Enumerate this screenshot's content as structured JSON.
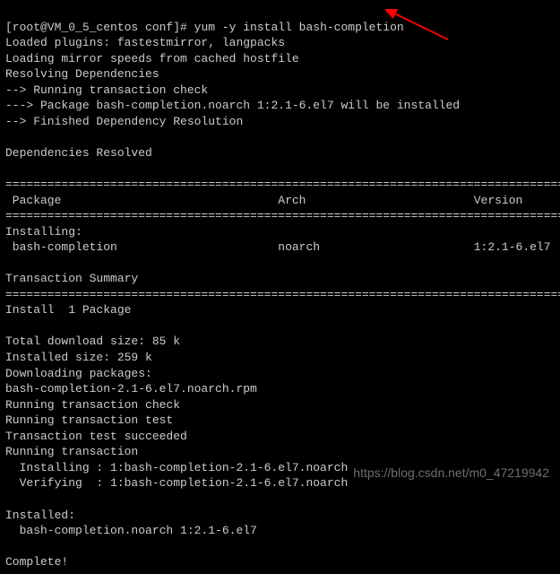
{
  "prompt": {
    "prefix": "[root@VM_0_5_centos conf]# ",
    "command": "yum -y install bash-completion"
  },
  "output": {
    "loaded_plugins": "Loaded plugins: fastestmirror, langpacks",
    "loading_mirror": "Loading mirror speeds from cached hostfile",
    "resolving": "Resolving Dependencies",
    "running_check": "--> Running transaction check",
    "package_install": "---> Package bash-completion.noarch 1:2.1-6.el7 will be installed",
    "finished_dep": "--> Finished Dependency Resolution",
    "deps_resolved": "Dependencies Resolved",
    "divider": "================================================================================",
    "header_package": " Package",
    "header_arch": "Arch",
    "header_version": "Version",
    "installing_label": "Installing:",
    "pkg_name": " bash-completion",
    "pkg_arch": "noarch",
    "pkg_version": "1:2.1-6.el7",
    "txn_summary": "Transaction Summary",
    "install_count": "Install  1 Package",
    "total_dl": "Total download size: 85 k",
    "installed_size": "Installed size: 259 k",
    "downloading": "Downloading packages:",
    "rpm_file": "bash-completion-2.1-6.el7.noarch.rpm",
    "run_txn_check": "Running transaction check",
    "run_txn_test": "Running transaction test",
    "txn_test_ok": "Transaction test succeeded",
    "run_txn": "Running transaction",
    "installing_line": "  Installing : 1:bash-completion-2.1-6.el7.noarch",
    "verifying_line": "  Verifying  : 1:bash-completion-2.1-6.el7.noarch",
    "installed_label": "Installed:",
    "installed_pkg": "  bash-completion.noarch 1:2.1-6.el7",
    "complete": "Complete!"
  },
  "watermark": "https://blog.csdn.net/m0_47219942"
}
